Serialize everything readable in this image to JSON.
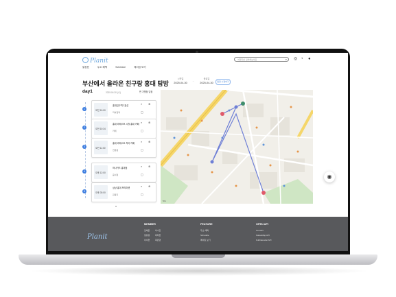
{
  "header": {
    "logo": "Planit",
    "nav": [
      "일정표",
      "두소 해택",
      "Schedule",
      "메이킹 보기"
    ],
    "search_placeholder": "여행지를 검색해보세요"
  },
  "plan": {
    "title": "부산에서 올라온 친구랑 홍대 탐방",
    "start_label": "시작일",
    "start_date": "2025-04-30",
    "end_label": "종료일",
    "end_date": "2025-04-30",
    "edit_label": "일정 수정하기"
  },
  "day": {
    "label": "day1",
    "date": "2025.04.30 (수)",
    "edit": "편 가맹점 입점"
  },
  "schedule": [
    {
      "num": "1",
      "time": "오전 10:00",
      "name": "홍대입구역 2호선",
      "category": "지하철역"
    },
    {
      "num": "2",
      "time": "오전 10:34",
      "name": "홍대 라떼스토 시월 홍대 카페",
      "category": "카페"
    },
    {
      "num": "3",
      "time": "오전 11:00",
      "name": "홍대 라떼스토 치아 카페",
      "category": "전문점"
    },
    {
      "num": "4",
      "time": "오후 12:00",
      "name": "하나카드 홍대점",
      "category": "음식점"
    },
    {
      "num": "5",
      "time": "오후 03:00",
      "name": "상상 홍대 프리마켓",
      "category": "관광지"
    }
  ],
  "map": {
    "scale": "50m",
    "route_color": "#6e7fd6",
    "road_color": "#f5d66a",
    "park_color": "#cfe6c4"
  },
  "footer": {
    "logo": "Planit",
    "member": {
      "title": "MEMBER",
      "rows": [
        [
          "김예은",
          "이수진"
        ],
        [
          "정유경",
          "박지현"
        ],
        [
          "이서현",
          "최은영"
        ]
      ]
    },
    "feature": {
      "title": "FEATURE",
      "items": [
        "두소 해택",
        "Schedule",
        "메이킹 보기"
      ]
    },
    "openapi": {
      "title": "OPEN API",
      "items": [
        "TourAPI",
        "KakaoMap API",
        "FullCalendar API"
      ]
    }
  }
}
